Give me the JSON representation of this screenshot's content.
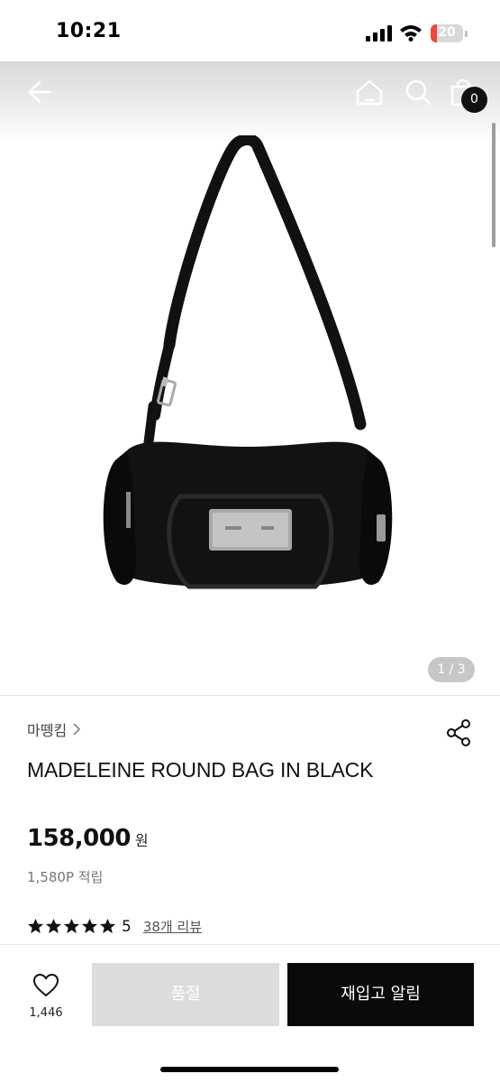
{
  "status_bar": {
    "time": "10:21",
    "battery_level": "20",
    "battery_fraction": 0.2,
    "battery_color": "#e84a3f"
  },
  "header": {
    "back_icon": "back-arrow-icon",
    "home_icon": "home-icon",
    "search_icon": "search-icon",
    "cart_icon": "shopping-bag-icon",
    "cart_count": "0"
  },
  "gallery": {
    "pager": "1 / 3"
  },
  "product": {
    "brand": "마뗑킴",
    "name": "MADELEINE ROUND BAG IN BLACK",
    "price": "158,000",
    "currency": "원",
    "points": "1,580P 적립",
    "rating": "5",
    "rating_stars": 5,
    "reviews": "38개 리뷰",
    "share_icon": "share-icon"
  },
  "actions": {
    "like_count": "1,446",
    "soldout_label": "품절",
    "restock_label": "재입고 알림"
  },
  "colors": {
    "primary_button": "#0a0a0a",
    "disabled_button": "#dcdcdc"
  }
}
